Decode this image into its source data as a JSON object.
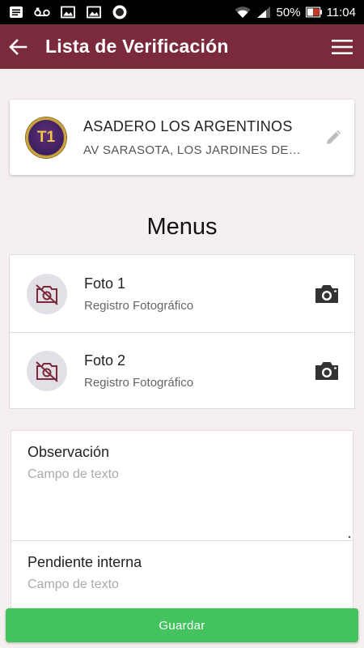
{
  "status_bar": {
    "battery": "50%",
    "time": "11:04",
    "icons": [
      "message-icon",
      "voicemail-icon",
      "image-icon",
      "image-icon",
      "circle-app-icon",
      "wifi-icon",
      "signal-icon",
      "battery-icon"
    ]
  },
  "app_bar": {
    "title": "Lista de Verificación",
    "back_icon": "arrow-left-icon",
    "menu_icon": "hamburger-menu-icon",
    "background": "#7b2a3c"
  },
  "store": {
    "badge": "T1",
    "name": "ASADERO LOS ARGENTINOS",
    "address": "AV SARASOTA, LOS JARDINES DE COLOMBIA",
    "edit_icon": "pencil-icon"
  },
  "section_title": "Menus",
  "photos": [
    {
      "title": "Foto 1",
      "subtitle": "Registro Fotográfico"
    },
    {
      "title": "Foto 2",
      "subtitle": "Registro Fotográfico"
    }
  ],
  "form": {
    "observation": {
      "label": "Observación",
      "placeholder": "Campo de texto"
    },
    "pending": {
      "label": "Pendiente interna",
      "placeholder": "Campo de texto"
    }
  },
  "save_button": {
    "label": "Guardar",
    "color": "#43c35e"
  }
}
